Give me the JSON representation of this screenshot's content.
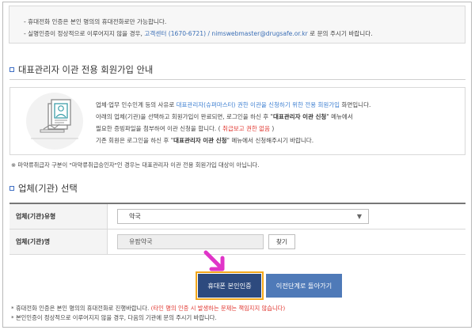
{
  "top_notice": {
    "line1": "- 휴대전화 인증은 본인 명의의 휴대전화로만 가능합니다.",
    "line2_prefix": "- 실명인증이 정상적으로 이루어지지 않을 경우, ",
    "line2_link": "고객센터 (1670-6721) / nimswebmaster@drugsafe.or.kr",
    "line2_suffix": " 로 문의 주시기 바랍니다."
  },
  "section1": {
    "title": "대표관리자 이관 전용 회원가입 안내",
    "info": {
      "l1_a": "업체·업무 인수인계 등의 사유로 ",
      "l1_b": "대표관리자(슈퍼마스터) 권한 이관을 신청하기 위한 전용 회원가입",
      "l1_c": " 화면입니다.",
      "l2_a": "아래의 업체(기관)을 선택하고 회원가입이 완료되면, 로그인을 하신 후 \"",
      "l2_b": "대표관리자 이관 신청",
      "l2_c": "\" 메뉴에서",
      "l3_a": "필요한 증빙파일을 첨부하여 이관 신청을 합니다. ( ",
      "l3_b": "취급보고 권한 없음",
      "l3_c": " )",
      "l4_a": "기존 회원은 로그인을 하신 후 \"",
      "l4_b": "대표관리자 이관 신청",
      "l4_c": "\" 메뉴에서 신청해주시기 바랍니다."
    },
    "footnote": "※ 마약류취급자 구분이 \"마약류취급승인자\"인 경우는 대표관리자 이관 전용 회원가입 대상이 아닙니다."
  },
  "section2": {
    "title": "업체(기관) 선택",
    "type_label": "업체(기관)유형",
    "type_value": "약국",
    "name_label": "업체(기관)명",
    "name_value": "유팜약국",
    "find_button": "찾기"
  },
  "buttons": {
    "verify": "휴대폰 본인인증",
    "prev": "이전단계로 돌아가기"
  },
  "bottom_notes": {
    "line1_a": "* 휴대전화 인증은 본인 명의의 휴대전화로 진행바랍니다. ",
    "line1_b": "(타인 명의 인증 시 발생하는 문제는 책임지지 않습니다)",
    "line2": "* 본인인증이 정상적으로 이루어지지 않을 경우, 다음의 기관에 문의 주시기 바랍니다."
  },
  "icons": {
    "section_marker": "square-bullet-icon",
    "select_arrow": "chevron-down-icon",
    "pointer": "pointer-arrow-icon",
    "illustration": "id-card-illustration"
  },
  "colors": {
    "verify_button": "#2d4a7e",
    "verify_highlight": "#f2a71b",
    "prev_button": "#4f7ab8",
    "emphasis_blue": "#3d7fd1",
    "warning_red": "#e0362f",
    "pointer": "#e034c8"
  }
}
